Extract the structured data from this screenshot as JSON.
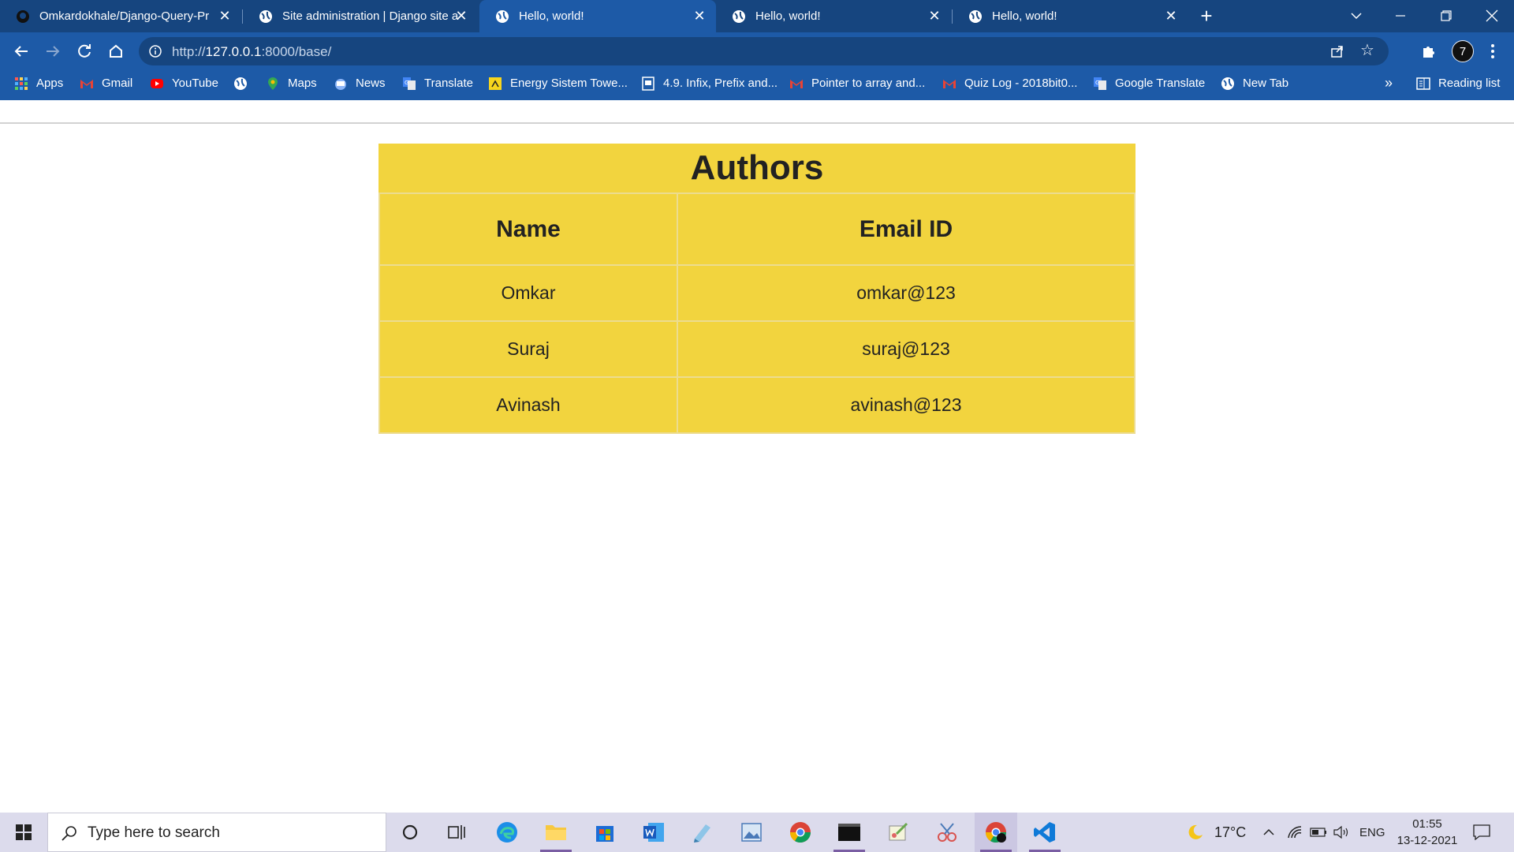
{
  "tabs": [
    {
      "title": "Omkardokhale/Django-Query-Pr",
      "icon": "github-icon",
      "active": false
    },
    {
      "title": "Site administration | Django site a",
      "icon": "globe-icon",
      "active": false
    },
    {
      "title": "Hello, world!",
      "icon": "globe-icon",
      "active": true
    },
    {
      "title": "Hello, world!",
      "icon": "globe-icon",
      "active": false
    },
    {
      "title": "Hello, world!",
      "icon": "globe-icon",
      "active": false
    }
  ],
  "tab_close_glyph": "✕",
  "new_tab_glyph": "+",
  "address": {
    "host": "127.0.0.1",
    "url_prefix": "http://",
    "url_rest": ":8000/base/"
  },
  "profile_initial": "7",
  "bookmarks": {
    "apps": "Apps",
    "gmail": "Gmail",
    "youtube": "YouTube",
    "maps": "Maps",
    "news": "News",
    "translate": "Translate",
    "energy": "Energy Sistem Towe...",
    "infix": "4.9. Infix, Prefix and...",
    "pointer": "Pointer to array and...",
    "quiz": "Quiz Log - 2018bit0...",
    "google_translate": "Google Translate",
    "new_tab": "New Tab",
    "more": "»",
    "reading_list": "Reading list"
  },
  "table": {
    "caption": "Authors",
    "headers": [
      "Name",
      "Email ID"
    ],
    "rows": [
      [
        "Omkar",
        "omkar@123"
      ],
      [
        "Suraj",
        "suraj@123"
      ],
      [
        "Avinash",
        "avinash@123"
      ]
    ]
  },
  "taskbar": {
    "search_placeholder": "Type here to search",
    "temperature": "17°C",
    "language": "ENG",
    "time": "01:55",
    "date": "13-12-2021"
  },
  "colors": {
    "chrome_frame": "#16457f",
    "chrome_toolbar": "#1d5aa7",
    "table_bg": "#f2d43e",
    "taskbar_bg": "#dcdbec"
  }
}
